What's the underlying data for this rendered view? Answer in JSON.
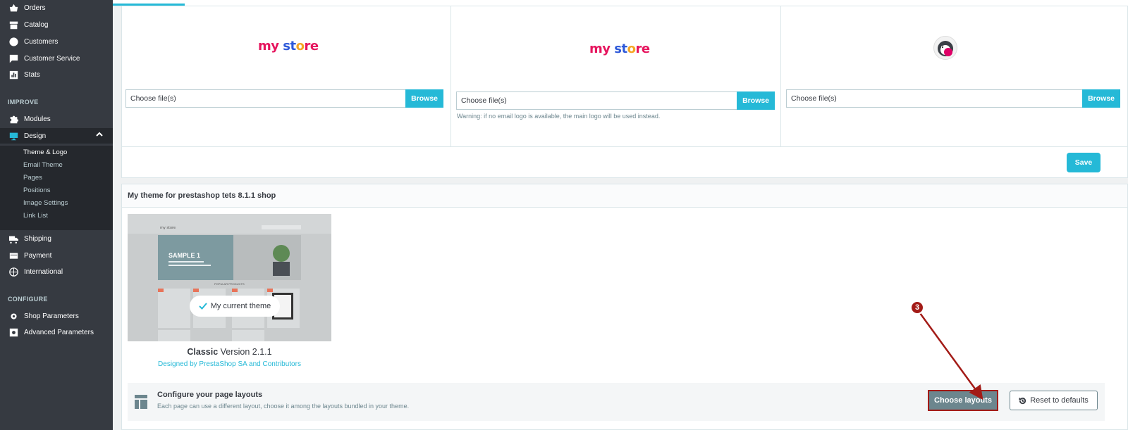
{
  "sidebar": {
    "top_items": [
      {
        "label": "Orders",
        "icon": "basket-icon"
      },
      {
        "label": "Catalog",
        "icon": "store-icon"
      },
      {
        "label": "Customers",
        "icon": "user-icon"
      },
      {
        "label": "Customer Service",
        "icon": "chat-icon"
      },
      {
        "label": "Stats",
        "icon": "bar-chart-icon"
      }
    ],
    "improve_label": "IMPROVE",
    "improve_items": [
      {
        "label": "Modules",
        "icon": "puzzle-icon"
      },
      {
        "label": "Design",
        "icon": "monitor-icon"
      }
    ],
    "design_sub": [
      "Theme & Logo",
      "Email Theme",
      "Pages",
      "Positions",
      "Image Settings",
      "Link List"
    ],
    "more_items": [
      {
        "label": "Shipping",
        "icon": "truck-icon"
      },
      {
        "label": "Payment",
        "icon": "credit-card-icon"
      },
      {
        "label": "International",
        "icon": "globe-icon"
      }
    ],
    "configure_label": "CONFIGURE",
    "configure_items": [
      {
        "label": "Shop Parameters",
        "icon": "gear-icon"
      },
      {
        "label": "Advanced Parameters",
        "icon": "cog-box-icon"
      }
    ]
  },
  "logos": {
    "col1": {
      "logo_text": "my store",
      "file_placeholder": "Choose file(s)",
      "browse": "Browse"
    },
    "col2": {
      "logo_text": "my store",
      "file_placeholder": "Choose file(s)",
      "browse": "Browse",
      "warning": "Warning: if no email logo is available, the main logo will be used instead."
    },
    "col3": {
      "file_placeholder": "Choose file(s)",
      "browse": "Browse"
    },
    "save": "Save"
  },
  "theme": {
    "header": "My theme for prestashop tets 8.1.1 shop",
    "current_badge": "My current theme",
    "name": "Classic",
    "version": "Version 2.1.1",
    "author": "Designed by PrestaShop SA and Contributors",
    "thumb_banner_title": "SAMPLE 1",
    "thumb_section": "POPULAR PRODUCTS",
    "thumb_logo": "my store"
  },
  "layouts": {
    "title": "Configure your page layouts",
    "description": "Each page can use a different layout, choose it among the layouts bundled in your theme.",
    "choose": "Choose layouts",
    "reset": "Reset to defaults"
  },
  "annotation": {
    "step": "3",
    "color": "#a31b17"
  },
  "colors": {
    "accent": "#25b9d7",
    "sidebar": "#363a41"
  }
}
